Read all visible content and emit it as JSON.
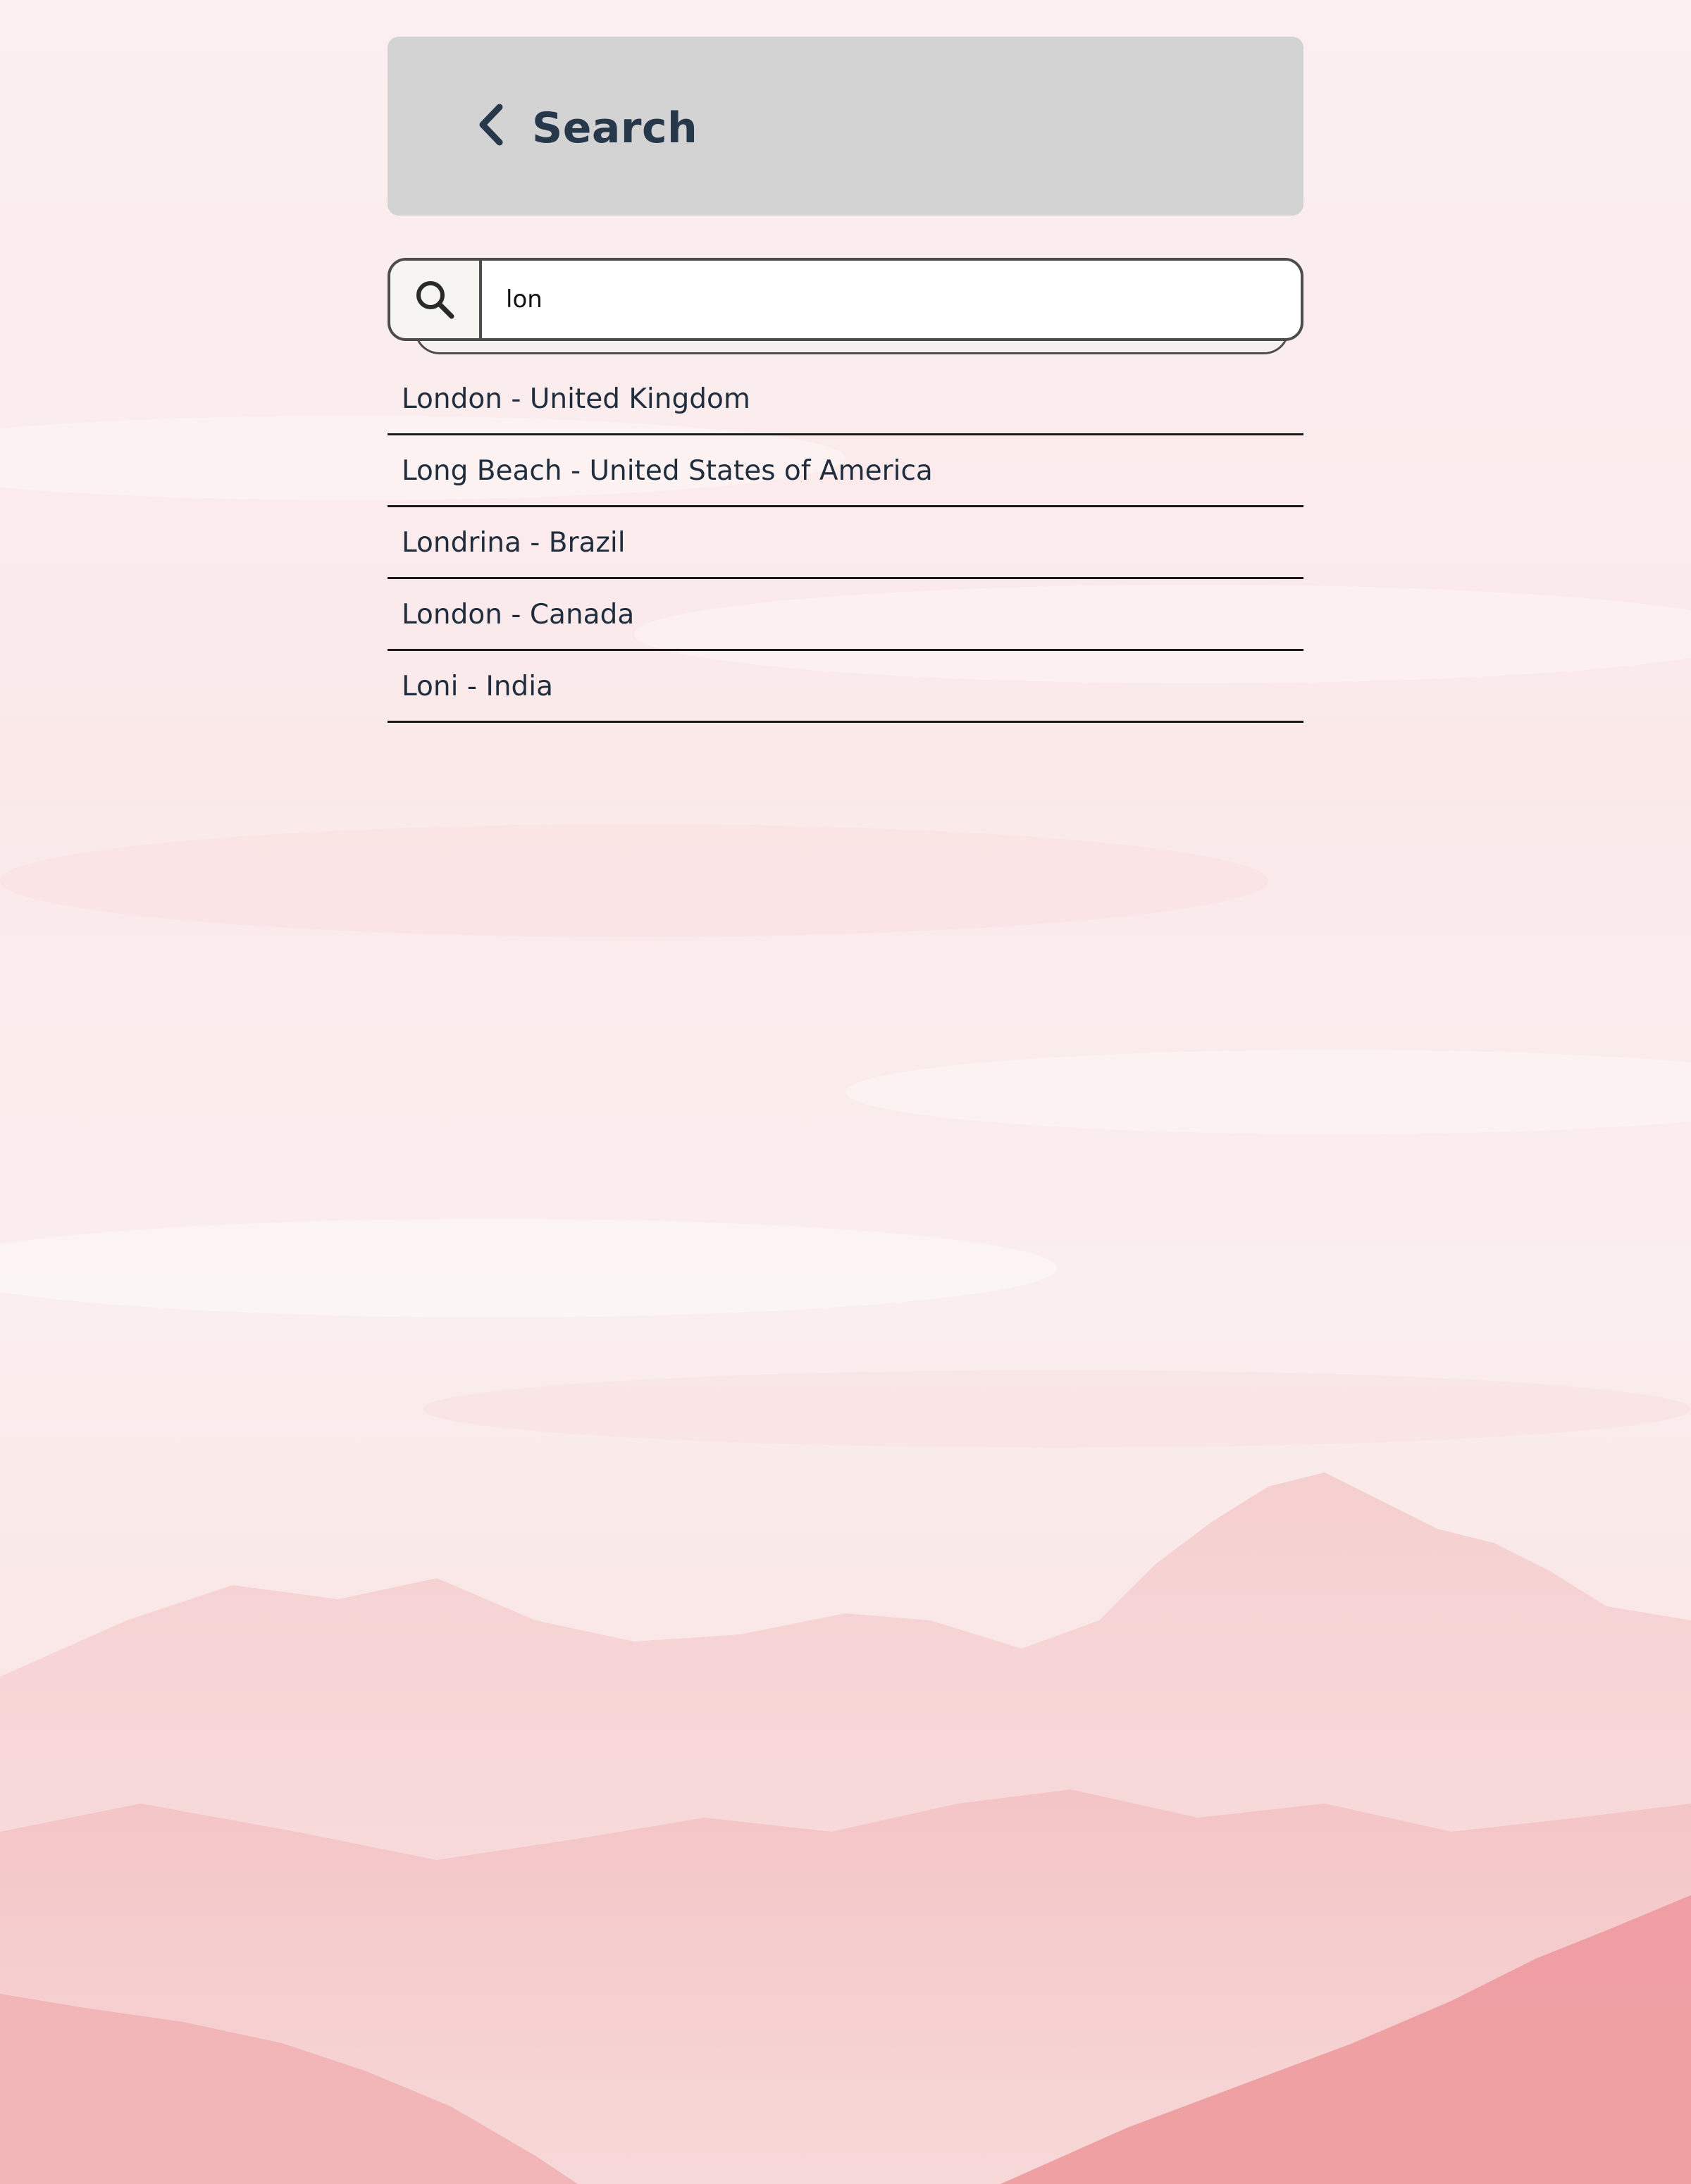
{
  "header": {
    "back_icon": "chevron-left-icon",
    "title": "Search"
  },
  "search": {
    "icon": "search-icon",
    "value": "lon"
  },
  "results": [
    {
      "label": "London - United Kingdom"
    },
    {
      "label": "Long Beach - United States of America"
    },
    {
      "label": "Londrina - Brazil"
    },
    {
      "label": "London - Canada"
    },
    {
      "label": "Loni - India"
    }
  ],
  "colors": {
    "header_bg": "#d3d3d3",
    "title_text": "#27384a",
    "border": "#4d4d4d",
    "background_tint": "#fbeeee"
  }
}
